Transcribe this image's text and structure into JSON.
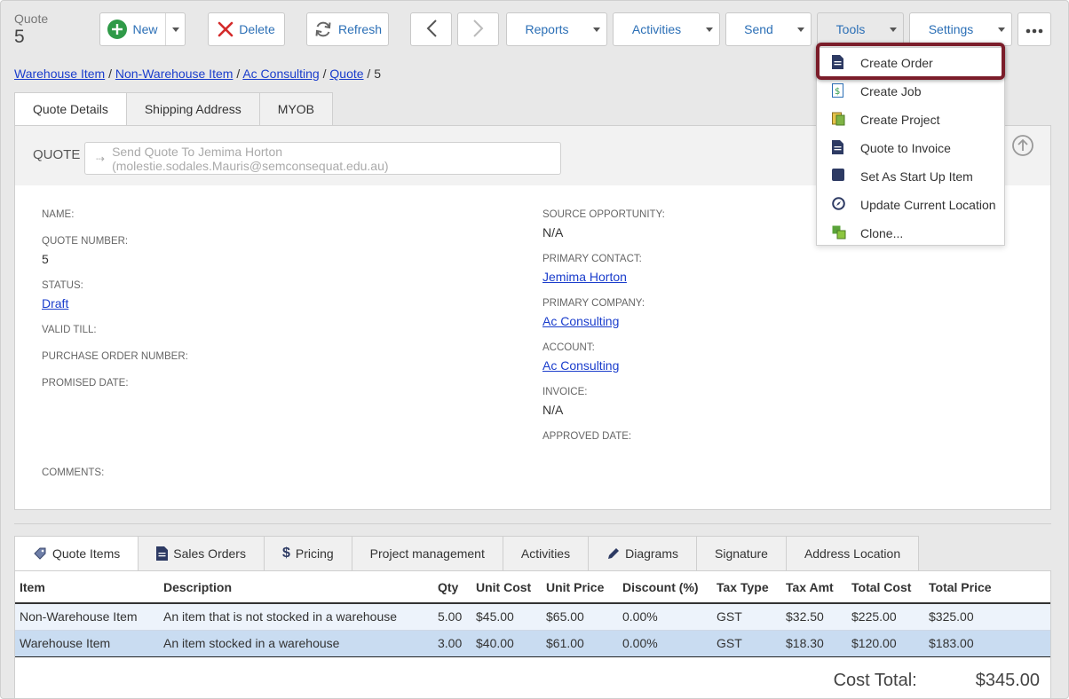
{
  "record": {
    "type": "Quote",
    "number": "5"
  },
  "toolbar": {
    "new_label": "New",
    "delete_label": "Delete",
    "refresh_label": "Refresh",
    "reports_label": "Reports",
    "activities_label": "Activities",
    "send_label": "Send",
    "tools_label": "Tools",
    "settings_label": "Settings"
  },
  "breadcrumb": {
    "items": [
      "Warehouse Item",
      "Non-Warehouse Item",
      "Ac Consulting",
      "Quote"
    ],
    "sep": "/",
    "current": "5"
  },
  "top_tabs": [
    "Quote Details",
    "Shipping Address",
    "MYOB"
  ],
  "panel": {
    "title": "QUOTE",
    "send_placeholder": "Send Quote To Jemima Horton (molestie.sodales.Mauris@semconsequat.edu.au)"
  },
  "fields_left": [
    {
      "label": "NAME:",
      "value": ""
    },
    {
      "label": "QUOTE NUMBER:",
      "value": "5"
    },
    {
      "label": "STATUS:",
      "value": "Draft"
    },
    {
      "label": "VALID TILL:",
      "value": ""
    },
    {
      "label": "PURCHASE ORDER NUMBER:",
      "value": ""
    },
    {
      "label": "PROMISED DATE:",
      "value": ""
    },
    {
      "label": "COMMENTS:",
      "value": ""
    }
  ],
  "fields_right": [
    {
      "label": "SOURCE OPPORTUNITY:",
      "value": "N/A"
    },
    {
      "label": "PRIMARY CONTACT:",
      "value": "Jemima Horton"
    },
    {
      "label": "PRIMARY COMPANY:",
      "value": "Ac Consulting"
    },
    {
      "label": "ACCOUNT:",
      "value": "Ac Consulting"
    },
    {
      "label": "INVOICE:",
      "value": "N/A"
    },
    {
      "label": "APPROVED DATE:",
      "value": ""
    }
  ],
  "bottom_tabs": [
    "Quote Items",
    "Sales Orders",
    "Pricing",
    "Project management",
    "Activities",
    "Diagrams",
    "Signature",
    "Address Location"
  ],
  "items_table": {
    "columns": [
      "Item",
      "Description",
      "Qty",
      "Unit Cost",
      "Unit Price",
      "Discount (%)",
      "Tax Type",
      "Tax Amt",
      "Total Cost",
      "Total Price"
    ],
    "rows": [
      [
        "Non-Warehouse Item",
        "An item that is not stocked in a warehouse",
        "5.00",
        "$45.00",
        "$65.00",
        "0.00%",
        "GST",
        "$32.50",
        "$225.00",
        "$325.00"
      ],
      [
        "Warehouse Item",
        "An item stocked in a warehouse",
        "3.00",
        "$40.00",
        "$61.00",
        "0.00%",
        "GST",
        "$18.30",
        "$120.00",
        "$183.00"
      ]
    ]
  },
  "totals": {
    "label": "Cost Total:",
    "value": "$345.00"
  },
  "tools_menu": {
    "items": [
      "Create Order",
      "Create Job",
      "Create Project",
      "Quote to Invoice",
      "Set As Start Up Item",
      "Update Current Location",
      "Clone..."
    ]
  },
  "colors": {
    "link": "#1a3dcc",
    "highlight": "#7b1d2a",
    "accent": "#2b6fb6"
  }
}
